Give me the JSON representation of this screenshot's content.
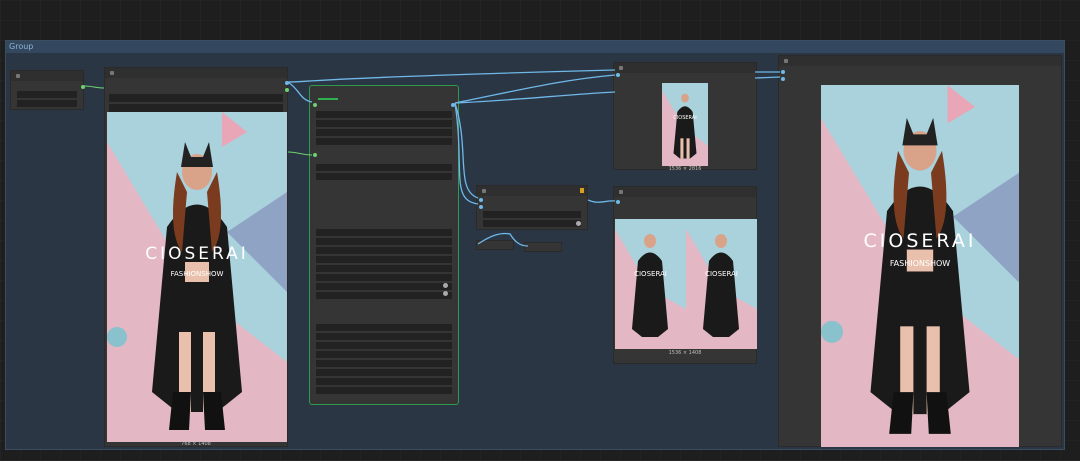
{
  "group": {
    "title": "Group"
  },
  "images": {
    "brand": "CIOSERAI",
    "subtitle": "FASHIONSHOW",
    "caption_load": "768 × 1408",
    "caption_preview_small": "1536 × 2816",
    "caption_preview_compare": "1536 × 1408"
  },
  "colors": {
    "wire": "#6fb8e8",
    "selected_border": "#2f9a4d",
    "group_bg": "#2a3644"
  }
}
